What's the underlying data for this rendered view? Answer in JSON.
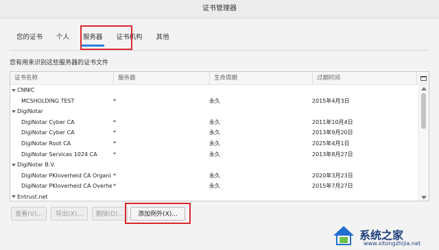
{
  "window": {
    "title": "证书管理器"
  },
  "tabs": [
    {
      "label": "您的证书"
    },
    {
      "label": "个人"
    },
    {
      "label": "服务器"
    },
    {
      "label": "证书机构"
    },
    {
      "label": "其他"
    }
  ],
  "active_tab": "服务器",
  "description": "您有用来识别这些服务器的证书文件",
  "table": {
    "columns": [
      "证书名称",
      "服务器",
      "生命周期",
      "过期时间"
    ],
    "groups": [
      {
        "name": "CNNIC",
        "rows": [
          {
            "name": "MCSHOLDING TEST",
            "server": "*",
            "lifetime": "永久",
            "expires": "2015年4月3日"
          }
        ]
      },
      {
        "name": "DigiNotar",
        "rows": [
          {
            "name": "DigiNotar Cyber CA",
            "server": "*",
            "lifetime": "永久",
            "expires": "2011年10月4日"
          },
          {
            "name": "DigiNotar Cyber CA",
            "server": "*",
            "lifetime": "永久",
            "expires": "2013年9月20日"
          },
          {
            "name": "DigiNotar Root CA",
            "server": "*",
            "lifetime": "永久",
            "expires": "2025年4月1日"
          },
          {
            "name": "DigiNotar Services 1024 CA",
            "server": "*",
            "lifetime": "永久",
            "expires": "2013年8月27日"
          }
        ]
      },
      {
        "name": "DigiNotar B.V.",
        "rows": [
          {
            "name": "DigiNotar PKIoverheid CA Organi...",
            "server": "*",
            "lifetime": "永久",
            "expires": "2020年3月23日"
          },
          {
            "name": "DigiNotar PKIoverheid CA Overhe...",
            "server": "*",
            "lifetime": "永久",
            "expires": "2015年7月27日"
          }
        ]
      },
      {
        "name": "Entrust.net",
        "rows": []
      }
    ]
  },
  "buttons": {
    "view": "查看(V)...",
    "export": "导出(X)...",
    "delete": "删除(D)...",
    "add_exception": "添加例外(X)..."
  },
  "watermark": {
    "text": "系统之家",
    "sub": "www.xitongzhijia.net"
  },
  "colors": {
    "accent": "#2a7de1",
    "highlight": "#d9262c"
  }
}
